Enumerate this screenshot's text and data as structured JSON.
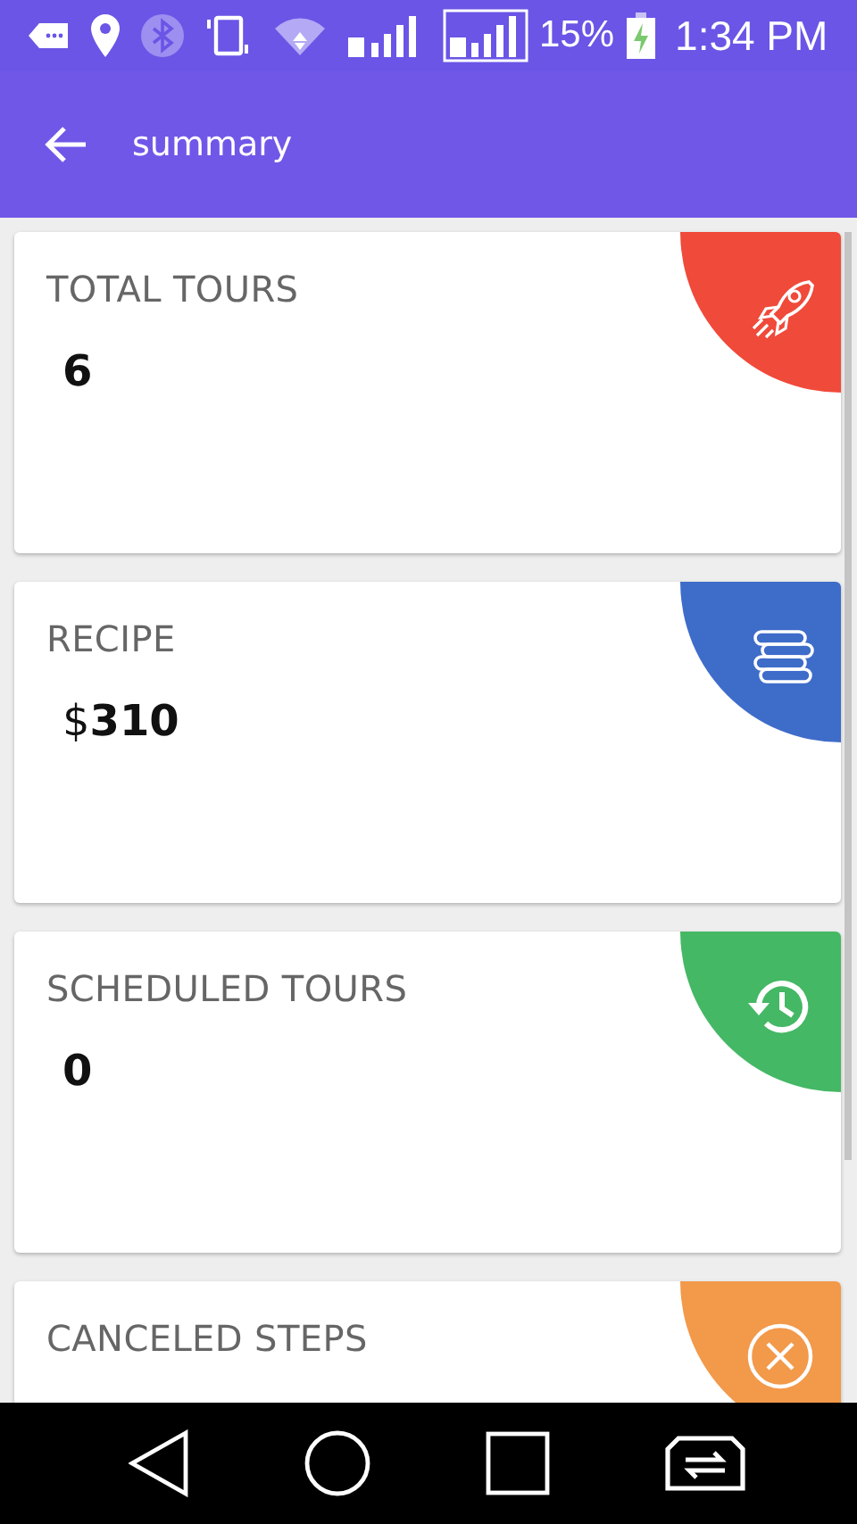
{
  "status_bar": {
    "battery": "15%",
    "time": "1:34 PM"
  },
  "app_bar": {
    "title": "summary"
  },
  "cards": [
    {
      "label": "TOTAL TOURS",
      "value": "6",
      "color": "#f04a3a"
    },
    {
      "label": "RECIPE",
      "currency": "$",
      "value": "310",
      "color": "#3e6cc9"
    },
    {
      "label": "SCHEDULED TOURS",
      "value": "0",
      "color": "#44b865"
    },
    {
      "label": "CANCELED STEPS",
      "color": "#f2994a"
    }
  ]
}
